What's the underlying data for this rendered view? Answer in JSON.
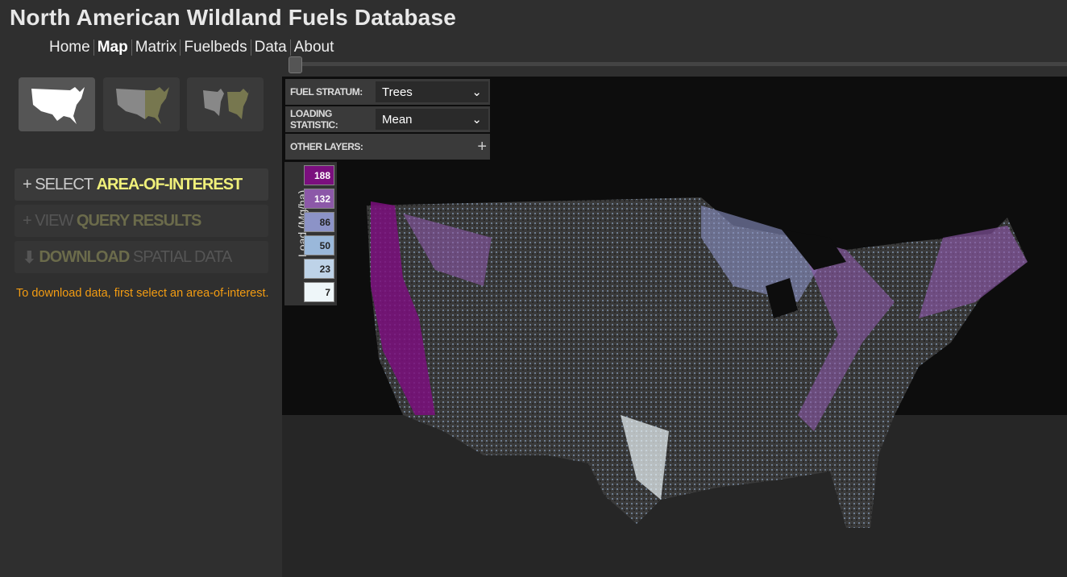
{
  "app": {
    "title": "North American Wildland Fuels Database"
  },
  "nav": [
    {
      "label": "Home"
    },
    {
      "label": "Map",
      "active": true
    },
    {
      "label": "Matrix"
    },
    {
      "label": "Fuelbeds"
    },
    {
      "label": "Data"
    },
    {
      "label": "About"
    }
  ],
  "map_modes": [
    {
      "icon": "us-map-single-icon",
      "active": true
    },
    {
      "icon": "us-map-swipe-icon"
    },
    {
      "icon": "us-map-side-by-side-icon"
    }
  ],
  "actions": {
    "select": {
      "prefix": "+ SELECT",
      "strong": "AREA-OF-INTEREST"
    },
    "view": {
      "prefix": "+ VIEW",
      "strong": "QUERY RESULTS"
    },
    "download": {
      "strong": "DOWNLOAD",
      "suffix": "SPATIAL DATA"
    }
  },
  "note": "To download data, first select an area-of-interest.",
  "controls": {
    "fuel_stratum": {
      "label": "FUEL STRATUM:",
      "value": "Trees"
    },
    "loading_statistic": {
      "label": "LOADING STATISTIC:",
      "value": "Mean"
    },
    "other_layers": {
      "label": "OTHER LAYERS:",
      "button": "+"
    }
  },
  "legend": {
    "title": "Load (Mg/ha)",
    "classes": [
      {
        "value": "188",
        "color": "#7b0f7e"
      },
      {
        "value": "132",
        "color": "#8c58a8"
      },
      {
        "value": "86",
        "color": "#8c93c7"
      },
      {
        "value": "50",
        "color": "#9ab8da"
      },
      {
        "value": "23",
        "color": "#bed3e8"
      },
      {
        "value": "7",
        "color": "#eef6f9"
      }
    ]
  },
  "colors": {
    "accent": "#f0f07a",
    "note": "#f39c12",
    "disabled_strong": "#6b6b4b"
  }
}
